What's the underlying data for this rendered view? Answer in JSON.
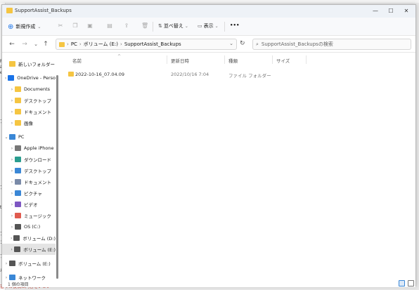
{
  "window": {
    "title": "SupportAssist_Backups",
    "controls": {
      "minimize": "—",
      "maximize": "☐",
      "close": "✕"
    }
  },
  "background": {
    "left_fragments": [
      "Re",
      "al",
      "e:",
      "ア",
      "ア",
      "t!",
      "ア",
      "ン",
      "ブ",
      "ルー"
    ],
    "bottom_text": "書くの役稿は内容をいさい"
  },
  "toolbar": {
    "new_label": "新規作成",
    "sort_label": "並べ替え",
    "view_label": "表示",
    "more_label": "•••"
  },
  "address": {
    "crumbs": [
      "PC",
      "ボリューム (E:)",
      "SupportAssist_Backups"
    ],
    "search_placeholder": "SupportAssist_Backupsの検索"
  },
  "nav": {
    "items": [
      {
        "label": "新しいフォルダー (",
        "indent": 1,
        "color": "#f5c542",
        "chev": ""
      },
      {
        "label": "OneDrive - Perso",
        "indent": 0,
        "color": "#1a73e8",
        "chev": "›"
      },
      {
        "label": "Documents",
        "indent": 1,
        "color": "#f5c542",
        "chev": "›"
      },
      {
        "label": "デスクトップ",
        "indent": 1,
        "color": "#f5c542",
        "chev": "›"
      },
      {
        "label": "ドキュメント",
        "indent": 1,
        "color": "#f5c542",
        "chev": "›"
      },
      {
        "label": "画像",
        "indent": 1,
        "color": "#f5c542",
        "chev": "›"
      },
      {
        "label": "PC",
        "indent": 0,
        "color": "#3a87d6",
        "chev": "⌄"
      },
      {
        "label": "Apple iPhone",
        "indent": 1,
        "color": "#777777",
        "chev": "›"
      },
      {
        "label": "ダウンロード",
        "indent": 1,
        "color": "#2a9d8f",
        "chev": "›"
      },
      {
        "label": "デスクトップ",
        "indent": 1,
        "color": "#3a87d6",
        "chev": "›"
      },
      {
        "label": "ドキュメント",
        "indent": 1,
        "color": "#7a8aa8",
        "chev": "›"
      },
      {
        "label": "ピクチャ",
        "indent": 1,
        "color": "#3a87d6",
        "chev": "›"
      },
      {
        "label": "ビデオ",
        "indent": 1,
        "color": "#7e57c2",
        "chev": "›"
      },
      {
        "label": "ミュージック",
        "indent": 1,
        "color": "#e05b4f",
        "chev": "›"
      },
      {
        "label": "OS (C:)",
        "indent": 1,
        "color": "#555555",
        "chev": "›"
      },
      {
        "label": "ボリューム (D:)",
        "indent": 1,
        "color": "#555555",
        "chev": "›"
      },
      {
        "label": "ボリューム (E:)",
        "indent": 1,
        "color": "#555555",
        "chev": "›",
        "selected": true
      },
      {
        "label": "ボリューム (E:)",
        "indent": 0,
        "color": "#555555",
        "chev": "›"
      },
      {
        "label": "ネットワーク",
        "indent": 0,
        "color": "#3a87d6",
        "chev": "›"
      }
    ]
  },
  "columns": {
    "name": "名前",
    "date": "更新日時",
    "type": "種類",
    "size": "サイズ"
  },
  "files": [
    {
      "name": "2022-10-16_07.04.09",
      "date": "2022/10/16 7:04",
      "type": "ファイル フォルダー",
      "size": ""
    }
  ],
  "status": {
    "count": "1 個の項目"
  },
  "colors": {
    "folder": "#f5c542",
    "accent": "#1a73e8",
    "selection": "#e4e4e4"
  }
}
